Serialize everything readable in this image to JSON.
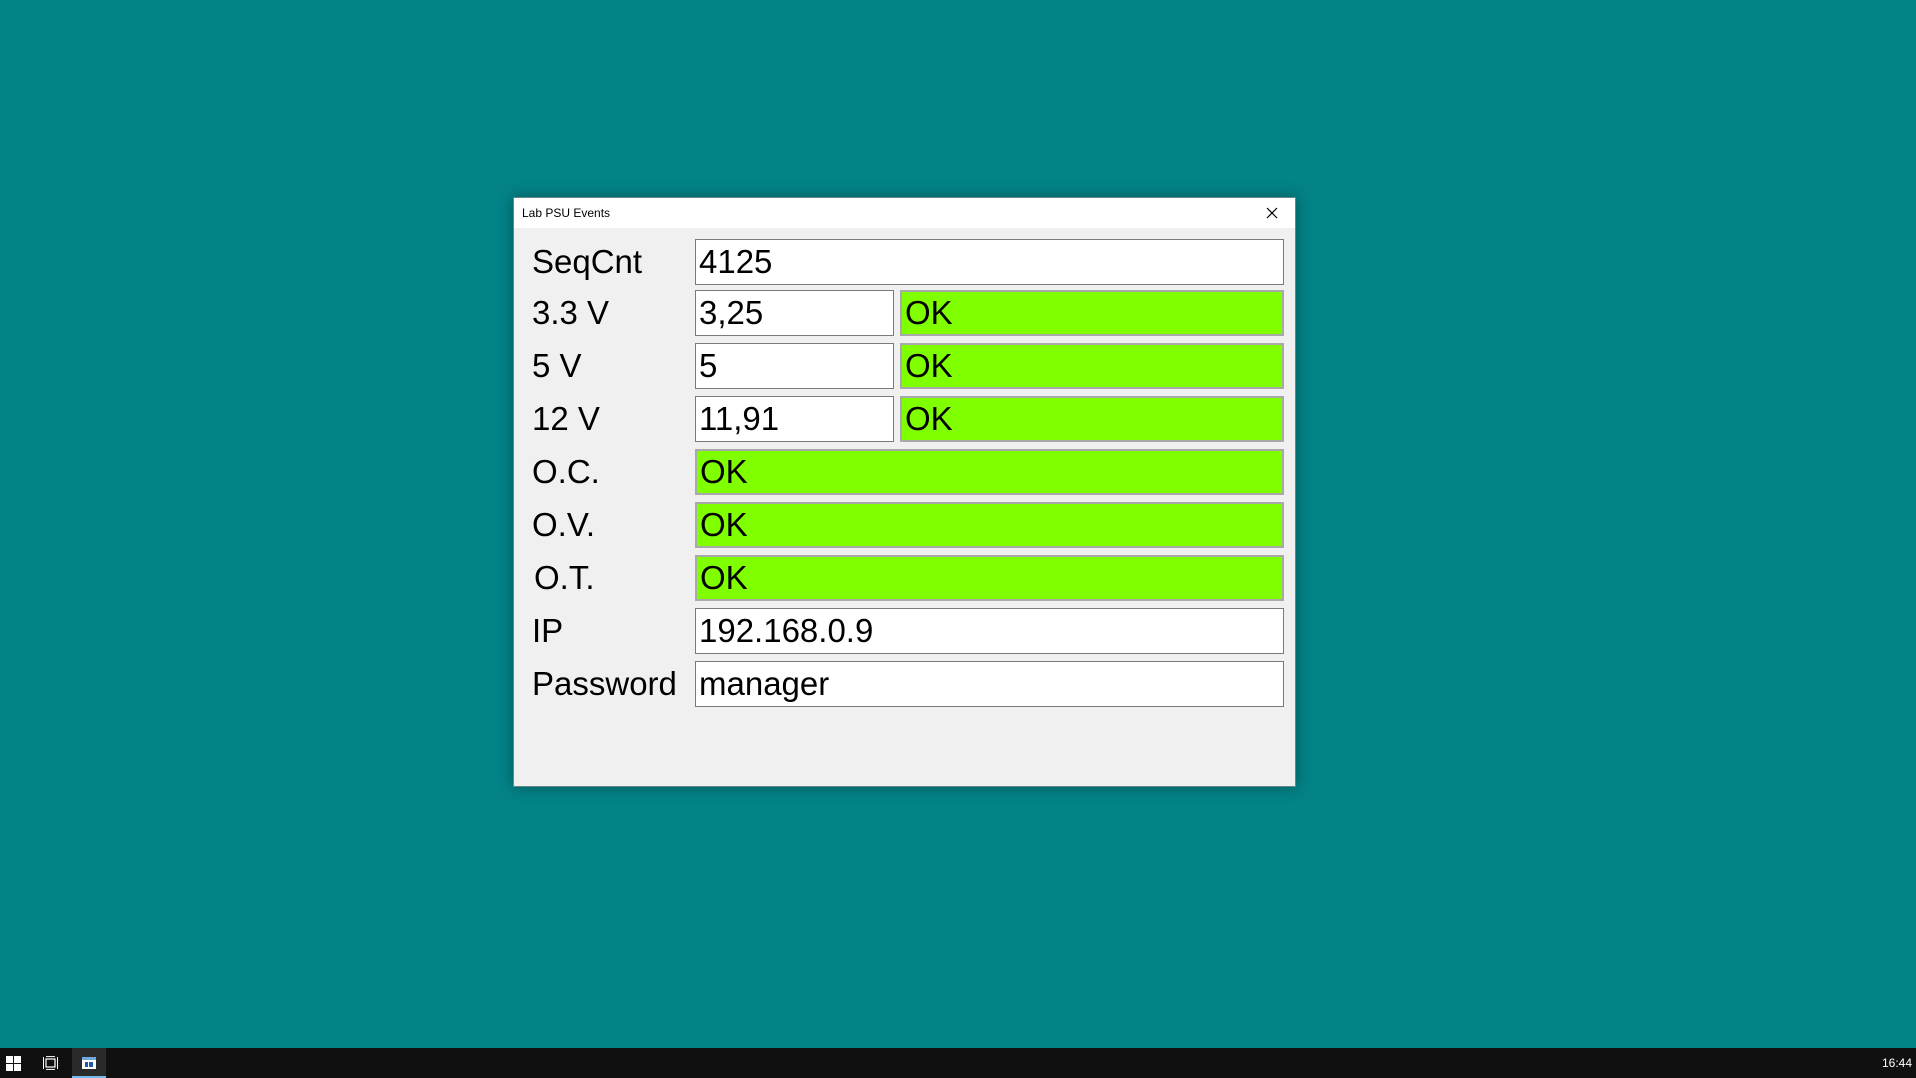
{
  "window": {
    "title": "Lab PSU Events",
    "close_icon": "close-icon"
  },
  "fields": {
    "seqcnt": {
      "label": "SeqCnt",
      "value": "4125"
    },
    "v33": {
      "label": "3.3 V",
      "value": "3,25",
      "status": "OK"
    },
    "v5": {
      "label": "5 V",
      "value": "5",
      "status": "OK"
    },
    "v12": {
      "label": "12 V",
      "value": "11,91",
      "status": "OK"
    },
    "oc": {
      "label": "O.C.",
      "status": "OK"
    },
    "ov": {
      "label": "O.V.",
      "status": "OK"
    },
    "ot": {
      "label": "O.T.",
      "status": "OK"
    },
    "ip": {
      "label": "IP",
      "value": "192.168.0.9"
    },
    "password": {
      "label": "Password",
      "value": "manager"
    }
  },
  "colors": {
    "desktop": "#038387",
    "status_ok": "#80ff00",
    "taskbar": "#101010"
  },
  "taskbar": {
    "start_icon": "windows-start-icon",
    "taskview_icon": "task-view-icon",
    "app_icon": "app-window-icon",
    "clock": "16:44"
  }
}
